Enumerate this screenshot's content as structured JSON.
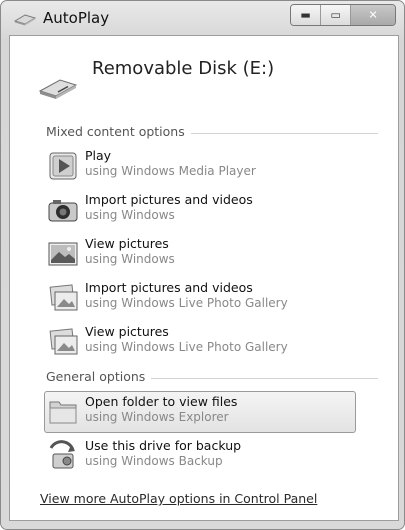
{
  "window": {
    "title": "AutoPlay"
  },
  "device": {
    "name": "Removable Disk (E:)"
  },
  "sections": {
    "mixed": "Mixed content options",
    "general": "General options"
  },
  "items": [
    {
      "title": "Play",
      "subtitle": "using Windows Media Player",
      "icon": "media-player-icon"
    },
    {
      "title": "Import pictures and videos",
      "subtitle": "using Windows",
      "icon": "camera-icon"
    },
    {
      "title": "View pictures",
      "subtitle": "using Windows",
      "icon": "picture-icon"
    },
    {
      "title": "Import pictures and videos",
      "subtitle": "using Windows Live Photo Gallery",
      "icon": "photo-gallery-icon"
    },
    {
      "title": "View pictures",
      "subtitle": "using Windows Live Photo Gallery",
      "icon": "photo-gallery-icon"
    },
    {
      "title": "Open folder to view files",
      "subtitle": "using Windows Explorer",
      "icon": "folder-icon",
      "selected": true
    },
    {
      "title": "Use this drive for backup",
      "subtitle": "using Windows Backup",
      "icon": "backup-icon"
    }
  ],
  "footer": {
    "link": "View more AutoPlay options in Control Panel"
  }
}
